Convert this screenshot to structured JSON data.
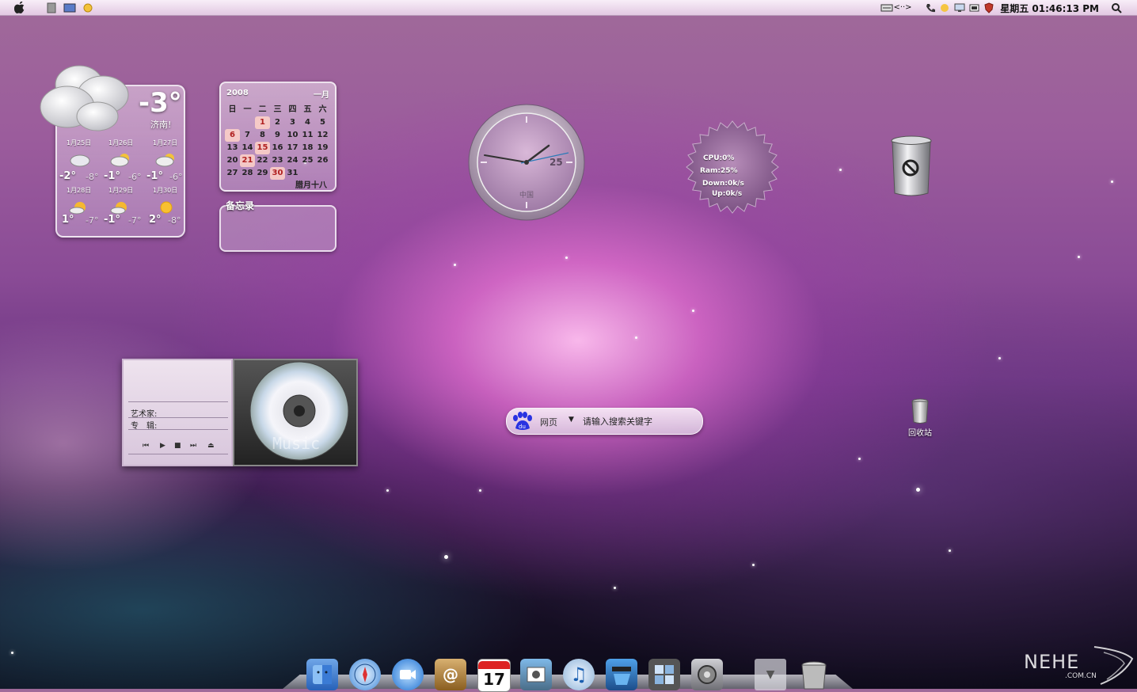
{
  "menubar": {
    "clock": "星期五 01:46:13 PM"
  },
  "weather": {
    "temperature": "-3°",
    "city": "济南!",
    "days": [
      {
        "date": "1月25日",
        "high": "-2°",
        "low": "-8°",
        "icon": "cloudy-icon"
      },
      {
        "date": "1月26日",
        "high": "-1°",
        "low": "-6°",
        "icon": "partly-cloudy-icon"
      },
      {
        "date": "1月27日",
        "high": "-1°",
        "low": "-6°",
        "icon": "partly-cloudy-icon"
      },
      {
        "date": "1月28日",
        "high": "1°",
        "low": "-7°",
        "icon": "partly-sunny-icon"
      },
      {
        "date": "1月29日",
        "high": "-1°",
        "low": "-7°",
        "icon": "partly-sunny-icon"
      },
      {
        "date": "1月30日",
        "high": "2°",
        "low": "-8°",
        "icon": "sunny-icon"
      }
    ]
  },
  "calendar": {
    "year": "2008",
    "month": "一月",
    "weekdays": [
      "日",
      "一",
      "二",
      "三",
      "四",
      "五",
      "六"
    ],
    "weeks": [
      [
        "",
        "",
        "1",
        "2",
        "3",
        "4",
        "5"
      ],
      [
        "6",
        "7",
        "8",
        "9",
        "10",
        "11",
        "12"
      ],
      [
        "13",
        "14",
        "15",
        "16",
        "17",
        "18",
        "19"
      ],
      [
        "20",
        "21",
        "22",
        "23",
        "24",
        "25",
        "26"
      ],
      [
        "27",
        "28",
        "29",
        "30",
        "31",
        "",
        ""
      ]
    ],
    "highlighted": [
      "1",
      "6",
      "15",
      "21",
      "30"
    ],
    "lunar": "腊月十八"
  },
  "memo": {
    "title": "备忘录"
  },
  "analog_clock": {
    "date": "25",
    "label": "中国",
    "time": "01:46:13"
  },
  "system_monitor": {
    "cpu": "CPU:0%",
    "ram": "Ram:25%",
    "down": "Down:0k/s",
    "up": "Up:0k/s"
  },
  "music_player": {
    "artist_label": "艺术家:",
    "album_label": "专　辑:",
    "controls": [
      "⏮",
      "▶",
      "■",
      "⏭",
      "⏏"
    ],
    "disc_text": "Music"
  },
  "search": {
    "category": "网页",
    "placeholder": "请输入搜索关键字"
  },
  "desktop": {
    "recycle_label": "回收站"
  },
  "dock": {
    "items": [
      "finder-icon",
      "safari-icon",
      "ichat-icon",
      "address-book-icon",
      "ical-icon",
      "iphoto-icon",
      "itunes-icon",
      "imovie-icon",
      "dashboard-icon",
      "system-preferences-icon",
      "downloads-icon",
      "trash-icon"
    ],
    "ical_day": "17"
  },
  "watermark": {
    "main": "NEHE",
    "sub": ".COM.CN"
  }
}
